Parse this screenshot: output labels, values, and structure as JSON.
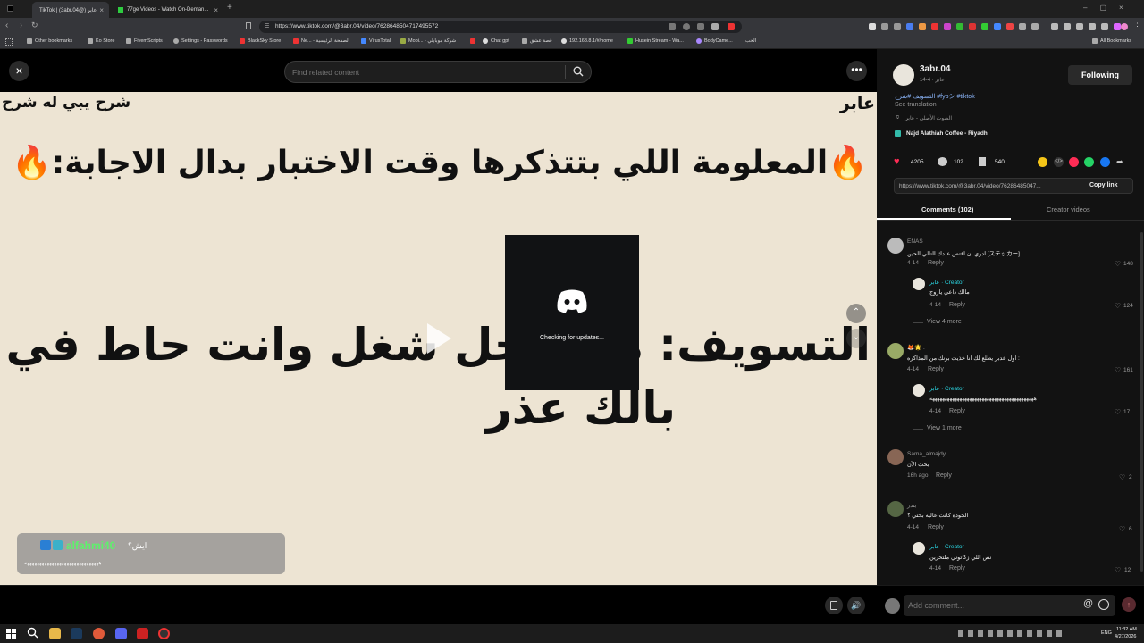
{
  "browser": {
    "tabs": [
      {
        "title": "TikTok | (3abr.04@) عابر",
        "active": true
      },
      {
        "title": "77ge Videos - Watch On-Deman...",
        "active": false
      }
    ],
    "url": "https://www.tiktok.com/@3abr.04/video/7628648504717495572",
    "bookmarks": [
      "Other bookmarks",
      "Ko Store",
      "FivemScripts",
      "Settings - Passwords",
      "BlackSky Store",
      "Ne... - الصفحة الرئيسية",
      "VirusTotal",
      "Mobi... - شركة موبايلي",
      "Chat gpt",
      "قصة عشق",
      "192.168.8.1/#/home",
      "Husein Stream - Wa...",
      "BodyCame...",
      "الحب"
    ],
    "all_bookmarks": "All Bookmarks"
  },
  "video": {
    "search_placeholder": "Find related content",
    "corner_right": "عابر",
    "corner_left": "شرح يبي له شرح",
    "headline_line1": "🔥المعلومة اللي بتتذكرها وقت الاختبار بدال الاجابة:🔥",
    "headline_line2": "التسويف: هل أأجل شغل وانت حاط في",
    "headline_line3": "بالك عذر",
    "discord_status": "Checking for updates...",
    "chat_user": "alfahmi40",
    "chat_text": "ايش؟",
    "chat_line2": "ههههههههههههههههههههههههههههههه"
  },
  "panel": {
    "username": "3abr.04",
    "subline": "عابر · 4-14",
    "follow_label": "Following",
    "caption": "التسويف #شرح #fypシ #tiktok",
    "see_translation": "See translation",
    "sound": "الصوت الأصلي - عابر",
    "location": "Najd Alathiah Coffee - Riyadh",
    "likes": "4205",
    "comments_count": "102",
    "saves": "540",
    "share_url": "https://www.tiktok.com/@3abr.04/video/76286485047...",
    "copy_link": "Copy link",
    "tab_comments": "Comments (102)",
    "tab_creator": "Creator videos",
    "comments": [
      {
        "user": "ENAS",
        "text": "ادري ان اقتص عندك التالي الحين [ステッカー]",
        "date": "4-14",
        "likes": "148"
      },
      {
        "user": "عابر · Creator",
        "text": "مالك داعي يازوج",
        "date": "4-14",
        "likes": "124",
        "reply": true
      },
      {
        "user": "🦊🌟 .",
        "text": "اول عدبر يطلع لك انا خذيت برنك من المذاكره :",
        "date": "4-14",
        "likes": "161"
      },
      {
        "user": "عابر · Creator",
        "text": "ههههههههههههههههههههههههههههههههههههههههههه",
        "date": "4-14",
        "likes": "17",
        "reply": true
      },
      {
        "user": "Sama_almajdy",
        "text": "بحث الآن",
        "date": "16h ago",
        "likes": "2"
      },
      {
        "user": "بندر",
        "text": "الجوده كانت عاليه بحتي ؟",
        "date": "4-14",
        "likes": "6"
      },
      {
        "user": "عابر · Creator",
        "text": "نص اللي زكاتوني ملتحرين",
        "date": "4-14",
        "likes": "12",
        "reply": true
      }
    ],
    "reply_label": "Reply",
    "view_more_1": "View 4 more",
    "view_more_2": "View 1 more",
    "add_comment_placeholder": "Add comment..."
  },
  "taskbar": {
    "time": "11:32 AM",
    "date": "4/27/2026",
    "lang": "ENG"
  }
}
